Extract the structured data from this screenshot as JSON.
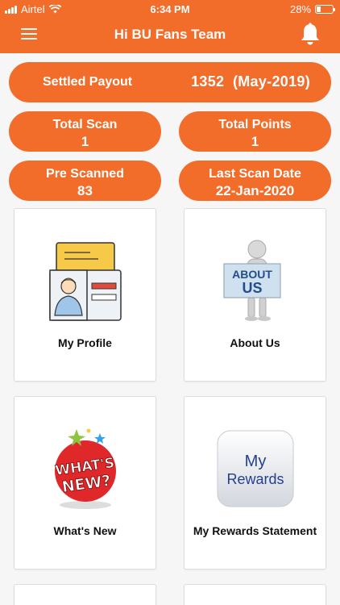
{
  "status_bar": {
    "carrier": "Airtel",
    "time": "6:34 PM",
    "battery": "28%",
    "battery_level": 0.28
  },
  "header": {
    "title": "Hi BU Fans Team",
    "menu_icon": "menu-icon",
    "bell_icon": "bell-icon"
  },
  "stats": {
    "payout": {
      "label": "Settled Payout",
      "value": "1352  (May-2019)"
    },
    "total_scan": {
      "label": "Total Scan",
      "value": "1"
    },
    "total_points": {
      "label": "Total Points",
      "value": "1"
    },
    "pre_scanned": {
      "label": "Pre Scanned",
      "value": "83"
    },
    "last_scan": {
      "label": "Last Scan Date",
      "value": "22-Jan-2020"
    }
  },
  "tiles": {
    "profile": {
      "label": "My Profile",
      "icon": "profile-card-icon"
    },
    "about": {
      "label": "About Us",
      "icon": "about-us-sign-icon",
      "sign_line1": "ABOUT",
      "sign_line2": "US"
    },
    "whats_new": {
      "label": "What's New",
      "icon": "whats-new-badge-icon",
      "badge_line1": "WHAT'S",
      "badge_line2": "NEW?"
    },
    "rewards": {
      "label": "My Rewards Statement",
      "icon": "rewards-app-icon",
      "icon_line1": "My",
      "icon_line2": "Rewards"
    }
  },
  "colors": {
    "brand_orange": "#f26c2a",
    "background": "#f6f6f6"
  }
}
